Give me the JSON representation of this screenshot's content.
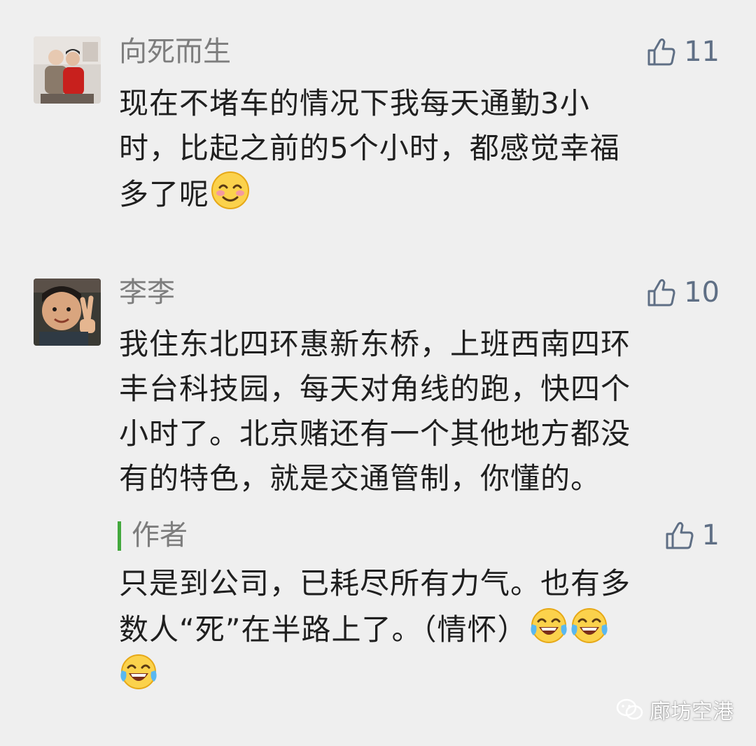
{
  "comments": [
    {
      "user": "向死而生",
      "likes": "11",
      "lines": [
        "现在不堵车的情况下我每天通勤3小",
        "时，比起之前的5个小时，都感觉幸福",
        "多了呢"
      ],
      "emoji": "blush-smile-emoji"
    },
    {
      "user": "李李",
      "likes": "10",
      "lines": [
        "我住东北四环惠新东桥，上班西南四环",
        "丰台科技园，每天对角线的跑，快四个",
        "小时了。北京赌还有一个其他地方都没",
        "有的特色，就是交通管制，你懂的。"
      ],
      "reply": {
        "label": "作者",
        "likes": "1",
        "lines": [
          "只是到公司，已耗尽所有力气。也有多",
          "数人“死”在半路上了。（情怀）"
        ],
        "emoji": "tears-of-joy-emoji"
      }
    }
  ],
  "watermark": {
    "icon": "wechat-icon",
    "text": "廊坊空港"
  },
  "colors": {
    "background": "#efefef",
    "like": "#5f6f85",
    "author_bar": "#43a83d"
  }
}
